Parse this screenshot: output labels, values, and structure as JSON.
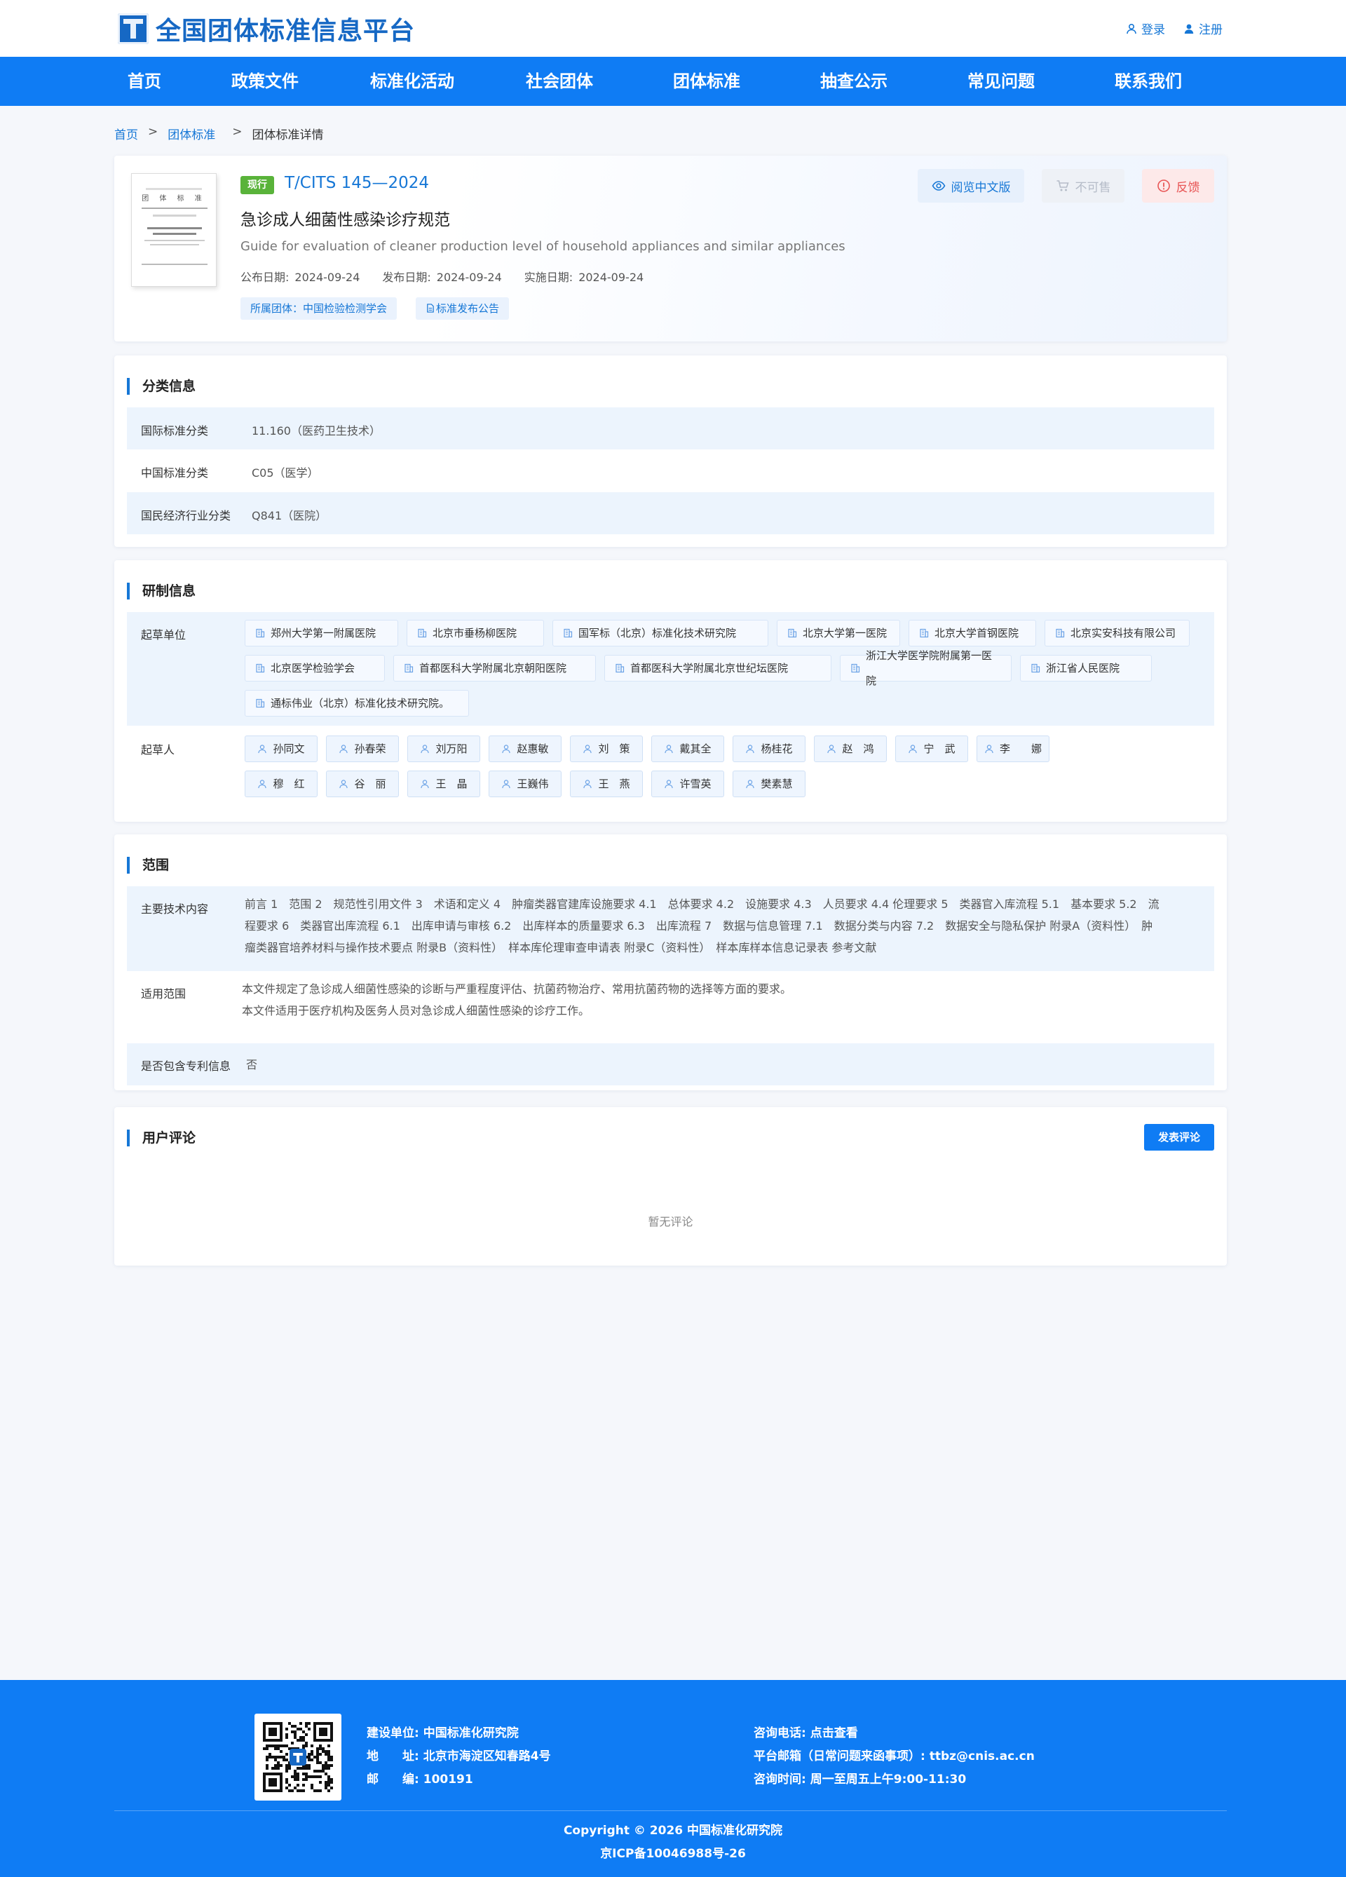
{
  "header": {
    "logo_text": "全国团体标准信息平台",
    "login": "登录",
    "register": "注册"
  },
  "nav": [
    "首页",
    "政策文件",
    "标准化活动",
    "社会团体",
    "团体标准",
    "抽查公示",
    "常见问题",
    "联系我们"
  ],
  "breadcrumb": {
    "home": "首页",
    "section": "团体标准",
    "sep": ">",
    "current": "团体标准详情"
  },
  "standard": {
    "cover_title": "团 体 标 准",
    "status": "现行",
    "code": "T/CITS 145—2024",
    "title": "急诊成人细菌性感染诊疗规范",
    "english_title": "Guide for evaluation of cleaner production level of household appliances and similar appliances",
    "announce_label": "公布日期:",
    "announce_date": "2024-09-24",
    "publish_label": "发布日期:",
    "publish_date": "2024-09-24",
    "implement_label": "实施日期:",
    "implement_date": "2024-09-24",
    "org_tag": "所属团体：中国检验检测学会",
    "notice_tag": "标准发布公告",
    "btn_read": "阅览中文版",
    "btn_nosale": "不可售",
    "btn_feedback": "反馈"
  },
  "classification": {
    "heading": "分类信息",
    "rows": [
      {
        "label": "国际标准分类",
        "value": "11.160（医药卫生技术）"
      },
      {
        "label": "中国标准分类",
        "value": "C05（医学）"
      },
      {
        "label": "国民经济行业分类",
        "value": "Q841（医院）"
      }
    ]
  },
  "development": {
    "heading": "研制信息",
    "units_label": "起草单位",
    "units": [
      "郑州大学第一附属医院",
      "北京市垂杨柳医院",
      "国军标（北京）标准化技术研究院",
      "北京大学第一医院",
      "北京大学首钢医院",
      "北京实安科技有限公司",
      "北京医学检验学会",
      "首都医科大学附属北京朝阳医院",
      "首都医科大学附属北京世纪坛医院",
      "浙江大学医学院附属第一医院",
      "浙江省人民医院",
      "通标伟业（北京）标准化技术研究院。"
    ],
    "people_label": "起草人",
    "people": [
      "孙同文",
      "孙春荣",
      "刘万阳",
      "赵惠敏",
      "刘　策",
      "戴其全",
      "杨桂花",
      "赵　鸿",
      "宁　武",
      "李　　娜",
      "穆　红",
      "谷　丽",
      "王　晶",
      "王巍伟",
      "王　燕",
      "许雪英",
      "樊素慧"
    ]
  },
  "scope": {
    "heading": "范围",
    "tech_label": "主要技术内容",
    "tech_lines": [
      "前言 1　范围 2　规范性引用文件 3　术语和定义 4　肿瘤类器官建库设施要求 4.1　总体要求 4.2　设施要求 4.3　人员要求 4.4 伦理要求 5　类器官入库流程 5.1　基本要求 5.2　流",
      "程要求 6　类器官出库流程 6.1　出库申请与审核 6.2　出库样本的质量要求 6.3　出库流程 7　数据与信息管理 7.1　数据分类与内容 7.2　数据安全与隐私保护 附录A（资料性）　肿",
      "瘤类器官培养材料与操作技术要点 附录B（资料性）　样本库伦理审查申请表 附录C（资料性）　样本库样本信息记录表 参考文献"
    ],
    "apply_label": "适用范围",
    "apply_lines": [
      "本文件规定了急诊成人细菌性感染的诊断与严重程度评估、抗菌药物治疗、常用抗菌药物的选择等方面的要求。",
      "本文件适用于医疗机构及医务人员对急诊成人细菌性感染的诊疗工作。"
    ],
    "patent_label": "是否包含专利信息",
    "patent_value": "否"
  },
  "comments": {
    "heading": "用户评论",
    "button": "发表评论",
    "empty": "暂无评论"
  },
  "footer": {
    "builder_label": "建设单位:",
    "builder": "中国标准化研究院",
    "address_label": "地　　址:",
    "address": "北京市海淀区知春路4号",
    "zip_label": "邮　　编:",
    "zip": "100191",
    "phone_label": "咨询电话:",
    "phone": "点击查看",
    "email_label": "平台邮箱（日常问题来函事项）:",
    "email": "ttbz@cnis.ac.cn",
    "hours_label": "咨询时间:",
    "hours": "周一至周五上午9:00-11:30",
    "copyright": "Copyright © 2026 中国标准化研究院",
    "icp": "京ICP备10046988号-26"
  },
  "colors": {
    "primary": "#0f7cf4",
    "accent": "#1677d6",
    "status_green": "#59b33a",
    "row_alt": "#ecf4fd"
  }
}
